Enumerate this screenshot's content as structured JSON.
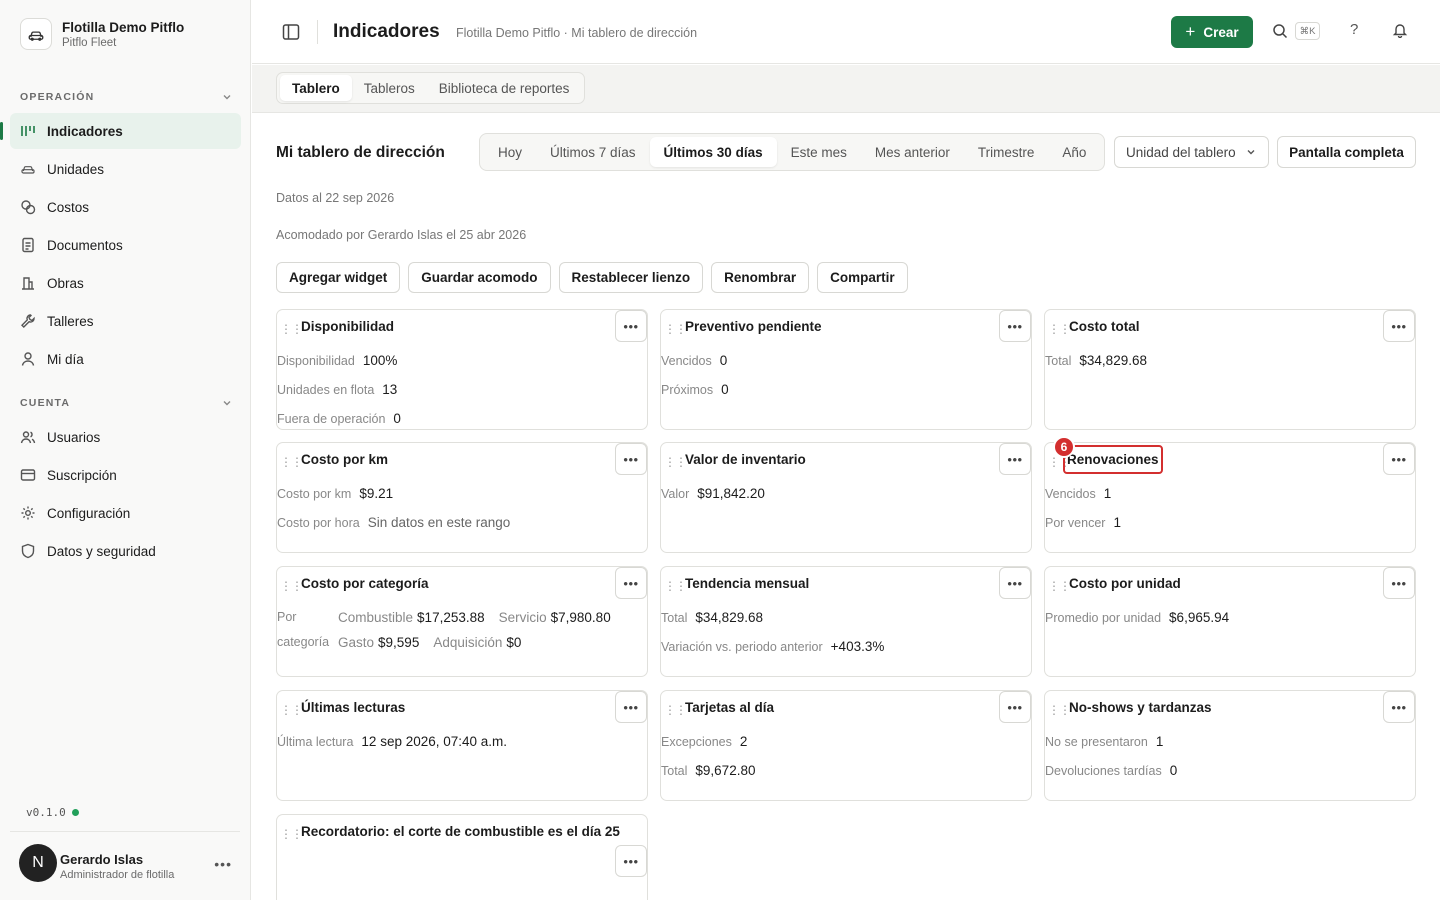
{
  "org": {
    "name": "Flotilla Demo Pitflo",
    "sub": "Pitflo Fleet"
  },
  "sidebar": {
    "section_operacion": "OPERACIÓN",
    "section_cuenta": "CUENTA",
    "operacion_items": [
      {
        "label": "Indicadores",
        "icon": "chart-icon"
      },
      {
        "label": "Unidades",
        "icon": "car-icon"
      },
      {
        "label": "Costos",
        "icon": "coins-icon"
      },
      {
        "label": "Documentos",
        "icon": "document-icon"
      },
      {
        "label": "Obras",
        "icon": "building-icon"
      },
      {
        "label": "Talleres",
        "icon": "wrench-icon"
      },
      {
        "label": "Mi día",
        "icon": "user-icon"
      }
    ],
    "cuenta_items": [
      {
        "label": "Usuarios",
        "icon": "users-icon"
      },
      {
        "label": "Suscripción",
        "icon": "credit-card-icon"
      },
      {
        "label": "Configuración",
        "icon": "gear-icon"
      },
      {
        "label": "Datos y seguridad",
        "icon": "shield-icon"
      }
    ],
    "version": "v0.1.0",
    "user": {
      "initial": "N",
      "name": "Gerardo Islas",
      "role": "Administrador de flotilla"
    }
  },
  "topbar": {
    "title": "Indicadores",
    "breadcrumb": "Flotilla Demo Pitflo · Mi tablero de dirección",
    "create_label": "Crear",
    "shortcut": "⌘K",
    "help": "?"
  },
  "tabs": [
    "Tablero",
    "Tableros",
    "Biblioteca de reportes"
  ],
  "dashboard": {
    "title": "Mi tablero de dirección",
    "ranges": [
      "Hoy",
      "Últimos 7 días",
      "Últimos 30 días",
      "Este mes",
      "Mes anterior",
      "Trimestre",
      "Año"
    ],
    "active_range": "Últimos 30 días",
    "unit_select": "Unidad del tablero",
    "fullscreen": "Pantalla completa",
    "data_as_of": "Datos al 22 sep 2026",
    "arranged_by": "Acomodado por Gerardo Islas el 25 abr 2026",
    "actions": [
      "Agregar widget",
      "Guardar acomodo",
      "Restablecer lienzo",
      "Renombrar",
      "Compartir"
    ]
  },
  "widgets": {
    "disponibilidad": {
      "title": "Disponibilidad",
      "rows": [
        [
          "Disponibilidad",
          "100%"
        ],
        [
          "Unidades en flota",
          "13"
        ],
        [
          "Fuera de operación",
          "0"
        ]
      ]
    },
    "preventivo": {
      "title": "Preventivo pendiente",
      "rows": [
        [
          "Vencidos",
          "0"
        ],
        [
          "Próximos",
          "0"
        ]
      ]
    },
    "costo_total": {
      "title": "Costo total",
      "rows": [
        [
          "Total",
          "$34,829.68"
        ]
      ]
    },
    "costo_km": {
      "title": "Costo por km",
      "rows": [
        [
          "Costo por km",
          "$9.21"
        ],
        [
          "Costo por hora",
          "Sin datos en este rango"
        ]
      ]
    },
    "inventario": {
      "title": "Valor de inventario",
      "rows": [
        [
          "Valor",
          "$91,842.20"
        ]
      ]
    },
    "renovaciones": {
      "title": "Renovaciones",
      "badge": "6",
      "rows": [
        [
          "Vencidos",
          "1"
        ],
        [
          "Por vencer",
          "1"
        ]
      ]
    },
    "categoria": {
      "title": "Costo por categoría",
      "label": "Por categoría",
      "line1": [
        [
          "Combustible",
          "$17,253.88"
        ],
        [
          "Servicio",
          "$7,980.80"
        ]
      ],
      "line2": [
        [
          "Gasto",
          "$9,595"
        ],
        [
          "Adquisición",
          "$0"
        ]
      ]
    },
    "tendencia": {
      "title": "Tendencia mensual",
      "rows": [
        [
          "Total",
          "$34,829.68"
        ],
        [
          "Variación vs. periodo anterior",
          "+403.3%"
        ]
      ]
    },
    "costo_unidad": {
      "title": "Costo por unidad",
      "rows": [
        [
          "Promedio por unidad",
          "$6,965.94"
        ]
      ]
    },
    "lecturas": {
      "title": "Últimas lecturas",
      "rows": [
        [
          "Última lectura",
          "12 sep 2026, 07:40 a.m."
        ]
      ]
    },
    "tarjetas": {
      "title": "Tarjetas al día",
      "rows": [
        [
          "Excepciones",
          "2"
        ],
        [
          "Total",
          "$9,672.80"
        ]
      ]
    },
    "noshows": {
      "title": "No-shows y tardanzas",
      "rows": [
        [
          "No se presentaron",
          "1"
        ],
        [
          "Devoluciones tardías",
          "0"
        ]
      ]
    },
    "recordatorio": {
      "title": "Recordatorio: el corte de combustible es el día 25"
    }
  },
  "colors": {
    "accent": "#1d7a46",
    "highlight": "#d32f2f",
    "active_nav_bg": "#e8f2ec"
  }
}
